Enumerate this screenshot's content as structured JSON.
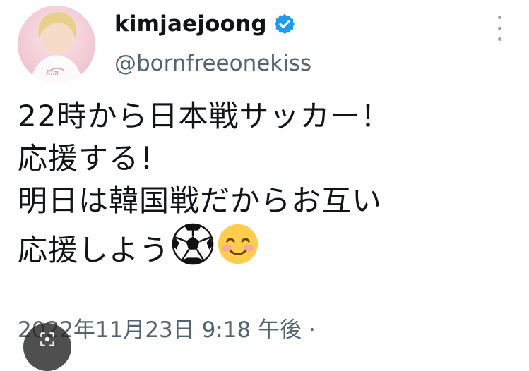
{
  "user": {
    "display_name": "kimjaejoong",
    "handle": "@bornfreeonekiss",
    "verified": true
  },
  "tweet": {
    "lines": [
      "22時から日本戦サッカー！",
      "応援する！",
      "明日は韓国戦だからお互い",
      "応援しよう"
    ],
    "emojis": [
      "soccer-ball-icon",
      "smiling-face-icon"
    ],
    "timestamp": "2022年11月23日 9:18 午後 ·"
  },
  "colors": {
    "text": "#0f1419",
    "secondary_text": "#536471",
    "verified_blue": "#1d9bf0"
  }
}
